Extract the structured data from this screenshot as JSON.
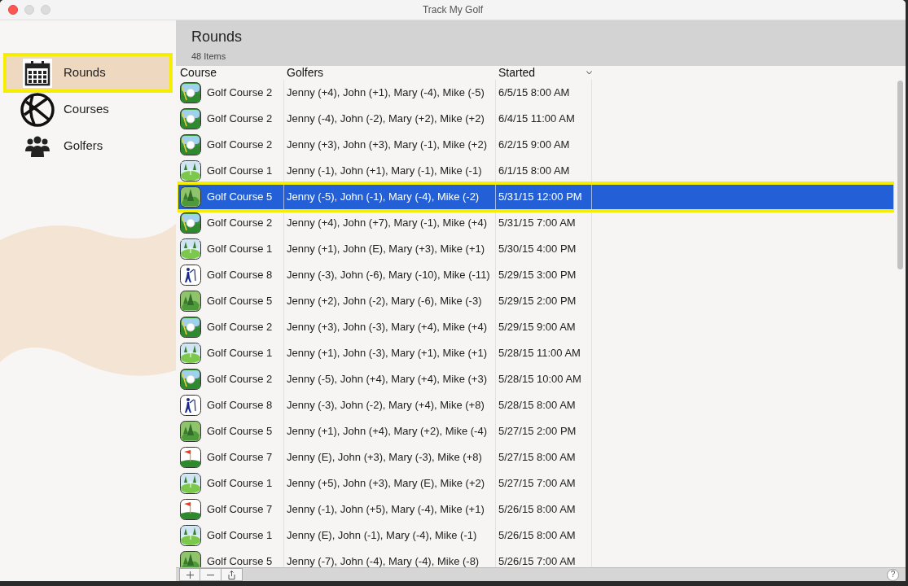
{
  "window": {
    "title": "Track My Golf"
  },
  "sidebar": {
    "items": [
      {
        "label": "Rounds",
        "kind": "calendar",
        "selected": true
      },
      {
        "label": "Courses",
        "kind": "globe",
        "selected": false
      },
      {
        "label": "Golfers",
        "kind": "people",
        "selected": false
      }
    ]
  },
  "header": {
    "title": "Rounds",
    "count": "48 Items"
  },
  "table": {
    "columns": [
      {
        "label": "Course",
        "sorted": false
      },
      {
        "label": "Golfers",
        "sorted": false
      },
      {
        "label": "Started",
        "sorted": true
      }
    ],
    "rows": [
      {
        "kind": "ball",
        "course": "Golf Course 2",
        "golfers": "Jenny (+4), John (+1), Mary (-4), Mike (-5)",
        "started": "6/5/15 8:00 AM",
        "selected": false
      },
      {
        "kind": "ball",
        "course": "Golf Course 2",
        "golfers": "Jenny (-4), John (-2), Mary (+2), Mike (+2)",
        "started": "6/4/15 11:00 AM",
        "selected": false
      },
      {
        "kind": "ball",
        "course": "Golf Course 2",
        "golfers": "Jenny (+3), John (+3), Mary (-1), Mike (+2)",
        "started": "6/2/15 9:00 AM",
        "selected": false
      },
      {
        "kind": "green",
        "course": "Golf Course 1",
        "golfers": "Jenny (-1), John (+1), Mary (-1), Mike (-1)",
        "started": "6/1/15 8:00 AM",
        "selected": false
      },
      {
        "kind": "trees",
        "course": "Golf Course 5",
        "golfers": "Jenny (-5), John (-1), Mary (-4), Mike (-2)",
        "started": "5/31/15 12:00 PM",
        "selected": true
      },
      {
        "kind": "ball",
        "course": "Golf Course 2",
        "golfers": "Jenny (+4), John (+7), Mary (-1), Mike (+4)",
        "started": "5/31/15 7:00 AM",
        "selected": false
      },
      {
        "kind": "green",
        "course": "Golf Course 1",
        "golfers": "Jenny (+1), John (E), Mary (+3), Mike (+1)",
        "started": "5/30/15 4:00 PM",
        "selected": false
      },
      {
        "kind": "golfer",
        "course": "Golf Course 8",
        "golfers": "Jenny (-3), John (-6), Mary (-10), Mike (-11)",
        "started": "5/29/15 3:00 PM",
        "selected": false
      },
      {
        "kind": "trees",
        "course": "Golf Course 5",
        "golfers": "Jenny (+2), John (-2), Mary (-6), Mike (-3)",
        "started": "5/29/15 2:00 PM",
        "selected": false
      },
      {
        "kind": "ball",
        "course": "Golf Course 2",
        "golfers": "Jenny (+3), John (-3), Mary (+4), Mike (+4)",
        "started": "5/29/15 9:00 AM",
        "selected": false
      },
      {
        "kind": "green",
        "course": "Golf Course 1",
        "golfers": "Jenny (+1), John (-3), Mary (+1), Mike (+1)",
        "started": "5/28/15 11:00 AM",
        "selected": false
      },
      {
        "kind": "ball",
        "course": "Golf Course 2",
        "golfers": "Jenny (-5), John (+4), Mary (+4), Mike (+3)",
        "started": "5/28/15 10:00 AM",
        "selected": false
      },
      {
        "kind": "golfer",
        "course": "Golf Course 8",
        "golfers": "Jenny (-3), John (-2), Mary (+4), Mike (+8)",
        "started": "5/28/15 8:00 AM",
        "selected": false
      },
      {
        "kind": "trees",
        "course": "Golf Course 5",
        "golfers": "Jenny (+1), John (+4), Mary (+2), Mike (-4)",
        "started": "5/27/15 2:00 PM",
        "selected": false
      },
      {
        "kind": "flag",
        "course": "Golf Course 7",
        "golfers": "Jenny (E), John (+3), Mary (-3), Mike (+8)",
        "started": "5/27/15 8:00 AM",
        "selected": false
      },
      {
        "kind": "green",
        "course": "Golf Course 1",
        "golfers": "Jenny (+5), John (+3), Mary (E), Mike (+2)",
        "started": "5/27/15 7:00 AM",
        "selected": false
      },
      {
        "kind": "flag",
        "course": "Golf Course 7",
        "golfers": "Jenny (-1), John (+5), Mary (-4), Mike (+1)",
        "started": "5/26/15 8:00 AM",
        "selected": false
      },
      {
        "kind": "green",
        "course": "Golf Course 1",
        "golfers": "Jenny (E), John (-1), Mary (-4), Mike (-1)",
        "started": "5/26/15 8:00 AM",
        "selected": false
      },
      {
        "kind": "trees",
        "course": "Golf Course 5",
        "golfers": "Jenny (-7), John (-4), Mary (-4), Mike (-8)",
        "started": "5/26/15 7:00 AM",
        "selected": false
      }
    ]
  },
  "bottom_bar": {
    "help": "?"
  }
}
